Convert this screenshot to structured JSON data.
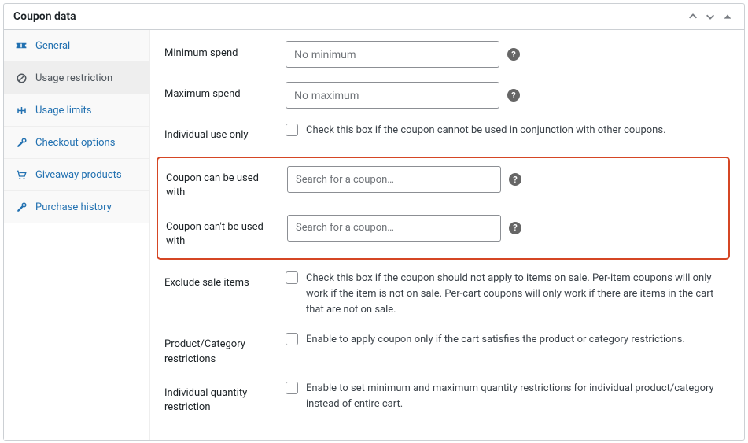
{
  "panel": {
    "title": "Coupon data"
  },
  "sidebar": {
    "items": [
      {
        "label": "General"
      },
      {
        "label": "Usage restriction"
      },
      {
        "label": "Usage limits"
      },
      {
        "label": "Checkout options"
      },
      {
        "label": "Giveaway products"
      },
      {
        "label": "Purchase history"
      }
    ]
  },
  "fields": {
    "minSpend": {
      "label": "Minimum spend",
      "placeholder": "No minimum"
    },
    "maxSpend": {
      "label": "Maximum spend",
      "placeholder": "No maximum"
    },
    "individualUse": {
      "label": "Individual use only",
      "desc": "Check this box if the coupon cannot be used in conjunction with other coupons."
    },
    "canBeUsed": {
      "label": "Coupon can be used with",
      "placeholder": "Search for a coupon…"
    },
    "cantBeUsed": {
      "label": "Coupon can't be used with",
      "placeholder": "Search for a coupon…"
    },
    "excludeSale": {
      "label": "Exclude sale items",
      "desc": "Check this box if the coupon should not apply to items on sale. Per-item coupons will only work if the item is not on sale. Per-cart coupons will only work if there are items in the cart that are not on sale."
    },
    "prodCat": {
      "label": "Product/Category restrictions",
      "desc": "Enable to apply coupon only if the cart satisfies the product or category restrictions."
    },
    "indivQty": {
      "label": "Individual quantity restriction",
      "desc": "Enable to set minimum and maximum quantity restrictions for individual product/category instead of entire cart."
    }
  }
}
